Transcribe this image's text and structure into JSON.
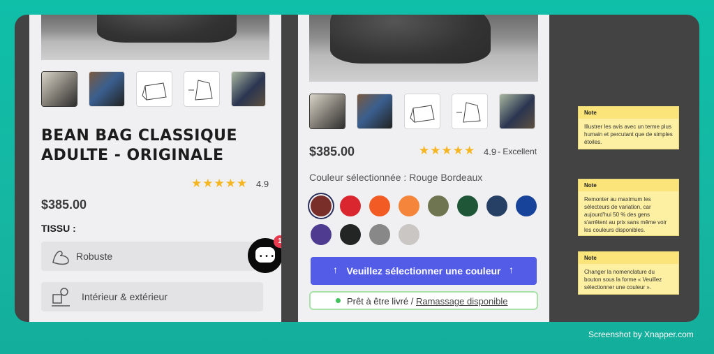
{
  "left": {
    "title_line1": "BEAN BAG CLASSIQUE",
    "title_line2": "ADULTE - ORIGINALE",
    "rating": "4.9",
    "stars": "★★★★★",
    "price": "$385.00",
    "tissu_label": "TISSU :",
    "features": [
      {
        "label": "Robuste",
        "icon": "flexed-arm-icon"
      },
      {
        "label": "Intérieur & extérieur",
        "icon": "indoor-outdoor-icon"
      }
    ],
    "chat_badge": "1"
  },
  "right": {
    "price": "$385.00",
    "stars": "★★★★★",
    "rating": "4.9",
    "rating_text": "- Excellent",
    "selected_color_label": "Couleur sélectionnée : Rouge Bordeaux",
    "swatches": [
      "#7a2e2a",
      "#d9262f",
      "#f35b25",
      "#f5853a",
      "#6f7550",
      "#1f5638",
      "#263f64",
      "#17449a",
      "#4f3b8f",
      "#232424",
      "#888888",
      "#c9c6c3"
    ],
    "cta_label": "Veuillez sélectionner une couleur",
    "cta_arrow": "↑",
    "stock_text": "Prêt à être livré / ",
    "stock_link": "Ramassage disponible"
  },
  "notes": [
    {
      "head": "Note",
      "body": "Illustrer les avis avec un terme plus humain et percutant que de simples étoiles."
    },
    {
      "head": "Note",
      "body": "Remonter au maximum les sélecteurs de variation, car aujourd'hui 50 % des gens s'arrêtent au prix sans même voir les couleurs disponibles."
    },
    {
      "head": "Note",
      "body": "Changer la nomenclature du bouton sous la forme « Veuillez sélectionner une couleur »."
    }
  ],
  "credit": "Screenshot by Xnapper.com"
}
